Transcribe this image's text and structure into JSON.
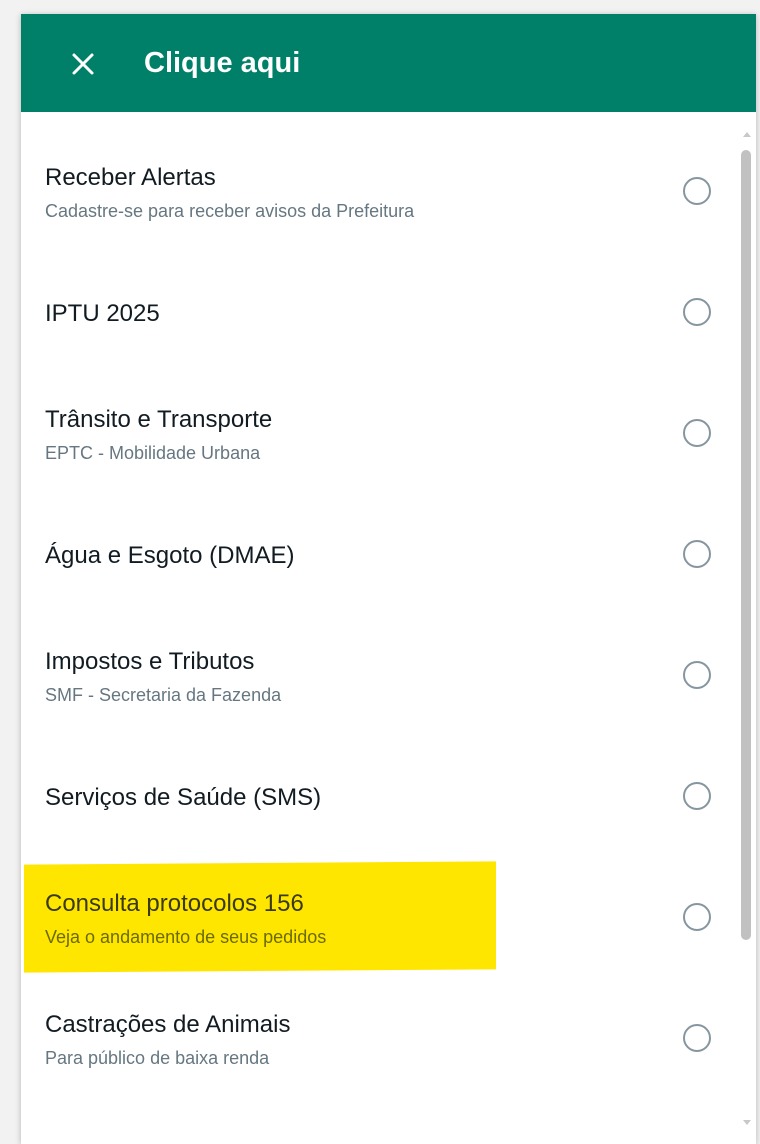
{
  "header": {
    "title": "Clique aqui",
    "close_icon": "close-icon",
    "background_color": "#008069"
  },
  "items": [
    {
      "title": "Receber Alertas",
      "subtitle": "Cadastre-se para receber avisos da Prefeitura",
      "selected": false
    },
    {
      "title": "IPTU 2025",
      "subtitle": "",
      "selected": false
    },
    {
      "title": "Trânsito e Transporte",
      "subtitle": "EPTC - Mobilidade Urbana",
      "selected": false
    },
    {
      "title": "Água e Esgoto (DMAE)",
      "subtitle": "",
      "selected": false
    },
    {
      "title": "Impostos e Tributos",
      "subtitle": "SMF - Secretaria da Fazenda",
      "selected": false
    },
    {
      "title": "Serviços de Saúde (SMS)",
      "subtitle": "",
      "selected": false
    },
    {
      "title": "Consulta protocolos 156",
      "subtitle": "Veja o andamento de seus pedidos",
      "selected": false,
      "highlighted": true
    },
    {
      "title": "Castrações de Animais",
      "subtitle": "Para público de baixa renda",
      "selected": false
    }
  ],
  "highlight_color": "#ffe600"
}
